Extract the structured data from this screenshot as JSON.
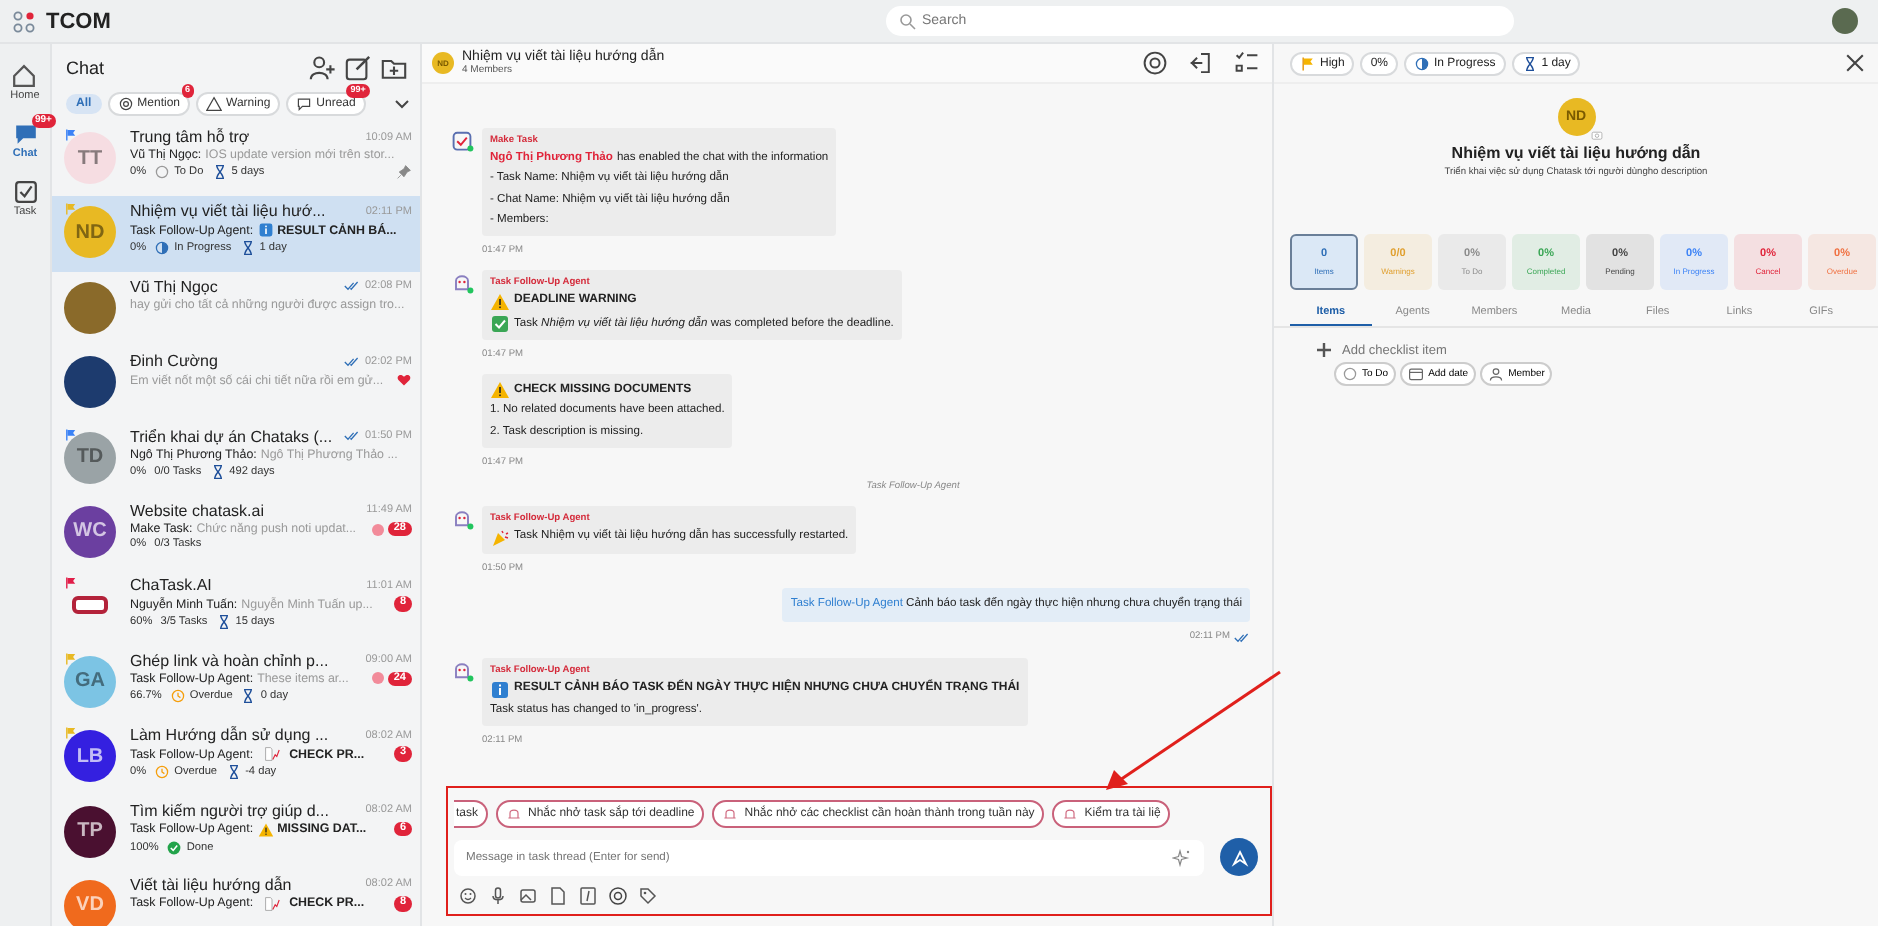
{
  "app": {
    "name": "TCOM"
  },
  "search": {
    "placeholder": "Search"
  },
  "rail": [
    {
      "label": "Home",
      "selected": false
    },
    {
      "label": "Chat",
      "selected": true,
      "badge": "99+"
    },
    {
      "label": "Task",
      "selected": false
    }
  ],
  "chat_list": {
    "title": "Chat",
    "filters": [
      {
        "label": "All",
        "selected": true
      },
      {
        "label": "Mention",
        "selected": false,
        "badge": "6"
      },
      {
        "label": "Warning",
        "selected": false
      },
      {
        "label": "Unread",
        "selected": false,
        "badge": "99+"
      }
    ],
    "items": [
      {
        "avatar": {
          "kind": "initials",
          "text": "TT",
          "color": "#f6dde2"
        },
        "flag": {
          "color": "#3b82f6"
        },
        "title": "Trung tâm hỗ trợ",
        "time": "10:09 AM",
        "read": false,
        "sender": "Vũ Thị Ngọc:",
        "preview": {
          "kind": "plain",
          "text": "IOS update version mới trên stor..."
        },
        "meta": [
          {
            "kind": "percent",
            "text": "0%"
          },
          {
            "kind": "todo",
            "text": "To Do"
          },
          {
            "kind": "duration",
            "text": "5 days"
          }
        ],
        "pinned": true,
        "liked": false,
        "dot": false,
        "selected": false
      },
      {
        "avatar": {
          "kind": "initials",
          "text": "ND",
          "color": "#e8b923"
        },
        "flag": {
          "color": "#e8b923"
        },
        "title": "Nhiệm vụ viết tài liệu hướ...",
        "time": "02:11 PM",
        "read": false,
        "sender": "Task Follow-Up Agent:",
        "preview": {
          "kind": "info",
          "text": "RESULT CẢNH BÁ..."
        },
        "meta": [
          {
            "kind": "percent",
            "text": "0%"
          },
          {
            "kind": "progress",
            "text": "In Progress"
          },
          {
            "kind": "duration",
            "text": "1 day"
          }
        ],
        "pinned": false,
        "liked": false,
        "dot": false,
        "selected": true
      },
      {
        "avatar": {
          "kind": "photo",
          "color": "#8a6a2a"
        },
        "title": "Vũ Thị Ngọc",
        "time": "02:08 PM",
        "read": true,
        "preview": {
          "kind": "plain",
          "text": "hay gửi cho tất cả những người được assign tro..."
        },
        "pinned": false,
        "liked": false,
        "dot": false,
        "selected": false
      },
      {
        "avatar": {
          "kind": "photo",
          "color": "#1d3b6e"
        },
        "title": "Đinh Cường",
        "time": "02:02 PM",
        "read": true,
        "preview": {
          "kind": "plain",
          "text": "Em viết nốt một số cái chi tiết nữa rồi em gử..."
        },
        "pinned": false,
        "liked": true,
        "dot": false,
        "selected": false
      },
      {
        "avatar": {
          "kind": "initials",
          "text": "TD",
          "color": "#9aa3a6"
        },
        "flag": {
          "color": "#3b82f6"
        },
        "title": "Triển khai dự án Chataks (...",
        "time": "01:50 PM",
        "read": true,
        "sender": "Ngô Thị Phương Thảo:",
        "preview": {
          "kind": "plain",
          "text": "Ngô Thị Phương Thảo ..."
        },
        "meta": [
          {
            "kind": "percent",
            "text": "0%"
          },
          {
            "kind": "tasks",
            "text": "0/0 Tasks"
          },
          {
            "kind": "duration",
            "text": "492 days"
          }
        ],
        "pinned": false,
        "liked": false,
        "dot": false,
        "selected": false
      },
      {
        "avatar": {
          "kind": "initials",
          "text": "WC",
          "color": "#6b3fa0"
        },
        "title": "Website chatask.ai",
        "time": "11:49 AM",
        "read": false,
        "sender": "Make Task:",
        "preview": {
          "kind": "plain",
          "text": "Chức năng push noti updat..."
        },
        "meta": [
          {
            "kind": "percent",
            "text": "0%"
          },
          {
            "kind": "tasks",
            "text": "0/3 Tasks"
          }
        ],
        "pinned": false,
        "liked": false,
        "dot": true,
        "badge": "28",
        "selected": false
      },
      {
        "avatar": {
          "kind": "logo",
          "color": "#b3223a"
        },
        "flag": {
          "color": "#e11d48"
        },
        "title": "ChaTask.AI",
        "time": "11:01 AM",
        "read": false,
        "sender": "Nguyễn Minh Tuấn:",
        "preview": {
          "kind": "plain",
          "text": "Nguyễn Minh Tuấn up..."
        },
        "meta": [
          {
            "kind": "percent",
            "text": "60%"
          },
          {
            "kind": "tasks",
            "text": "3/5 Tasks"
          },
          {
            "kind": "duration",
            "text": "15 days"
          }
        ],
        "pinned": false,
        "liked": false,
        "dot": false,
        "badge": "8",
        "selected": false
      },
      {
        "avatar": {
          "kind": "initials",
          "text": "GA",
          "color": "#7cc4e4"
        },
        "flag": {
          "color": "#e8b923"
        },
        "title": "Ghép link và hoàn chỉnh p...",
        "time": "09:00 AM",
        "read": false,
        "sender": "Task Follow-Up Agent:",
        "preview": {
          "kind": "plain",
          "text": "These items ar..."
        },
        "meta": [
          {
            "kind": "percent",
            "text": "66.7%"
          },
          {
            "kind": "overdue",
            "text": "Overdue"
          },
          {
            "kind": "duration",
            "text": "0 day"
          }
        ],
        "pinned": false,
        "liked": false,
        "dot": true,
        "badge": "24",
        "selected": false
      },
      {
        "avatar": {
          "kind": "initials",
          "text": "LB",
          "color": "#3420e0"
        },
        "flag": {
          "color": "#e8b923"
        },
        "title": "Làm Hướng dẫn sử dụng ...",
        "time": "08:02 AM",
        "read": false,
        "sender": "Task Follow-Up Agent:",
        "preview": {
          "kind": "report",
          "text": "CHECK PR..."
        },
        "meta": [
          {
            "kind": "percent",
            "text": "0%"
          },
          {
            "kind": "overdue",
            "text": "Overdue"
          },
          {
            "kind": "duration",
            "text": "-4 day"
          }
        ],
        "pinned": false,
        "liked": false,
        "dot": false,
        "badge": "3",
        "selected": false
      },
      {
        "avatar": {
          "kind": "initials",
          "text": "TP",
          "color": "#4a1030"
        },
        "title": "Tìm kiếm người trợ giúp d...",
        "time": "08:02 AM",
        "read": false,
        "sender": "Task Follow-Up Agent:",
        "preview": {
          "kind": "warning",
          "text": "MISSING DAT..."
        },
        "meta": [
          {
            "kind": "percent",
            "text": "100%"
          },
          {
            "kind": "done",
            "text": "Done"
          }
        ],
        "pinned": false,
        "liked": false,
        "dot": false,
        "badge": "6",
        "selected": false
      },
      {
        "avatar": {
          "kind": "initials",
          "text": "VD",
          "color": "#f06a1d"
        },
        "title": "Viết tài liệu hướng dẫn",
        "time": "08:02 AM",
        "read": false,
        "sender": "Task Follow-Up Agent:",
        "preview": {
          "kind": "report",
          "text": "CHECK PR..."
        },
        "pinned": false,
        "liked": false,
        "dot": false,
        "badge": "8",
        "selected": false
      }
    ]
  },
  "conversation": {
    "avatar": "ND",
    "title": "Nhiệm vụ viết tài liệu hướng dẫn",
    "subtitle": "4 Members",
    "messages": [
      {
        "kind": "incoming",
        "agent": {
          "kind": "task"
        },
        "sender": "Make Task",
        "mention": "Ngô Thị Phương Thảo",
        "text": "has enabled the chat with the information",
        "lines": [
          {
            "kind": "plain",
            "text": "- Task Name: Nhiệm vụ viết tài liệu hướng dẫn"
          },
          {
            "kind": "plain",
            "text": "- Chat Name: Nhiệm vụ viết tài liệu hướng dẫn"
          },
          {
            "kind": "plain",
            "text": "- Members:"
          }
        ],
        "time": "01:47 PM"
      },
      {
        "kind": "incoming",
        "agent": {
          "kind": "bot"
        },
        "sender": "Task Follow-Up Agent",
        "heading": {
          "kind": "warning",
          "text": "DEADLINE WARNING"
        },
        "lines": [
          {
            "kind": "check",
            "text": "Task *Nhiệm vụ viết tài liệu hướng dẫn* was completed before the deadline."
          }
        ],
        "time": "01:47 PM"
      },
      {
        "kind": "incoming",
        "heading": {
          "kind": "warning",
          "text": "CHECK MISSING DOCUMENTS"
        },
        "lines": [
          {
            "kind": "plain",
            "text": "1. No related documents have been attached."
          },
          {
            "kind": "plain",
            "text": "2. Task description is missing."
          }
        ],
        "time": "01:47 PM"
      },
      {
        "kind": "system",
        "text": "Task Follow-Up Agent"
      },
      {
        "kind": "incoming",
        "agent": {
          "kind": "bot"
        },
        "sender": "Task Follow-Up Agent",
        "lines": [
          {
            "kind": "party",
            "text": "Task Nhiệm vụ viết tài liệu hướng dẫn has successfully restarted."
          }
        ],
        "time": "01:50 PM"
      },
      {
        "kind": "outgoing",
        "mention": "Task Follow-Up Agent",
        "text": "Cảnh báo task đến ngày thực hiện nhưng chưa chuyển trạng thái",
        "time": "02:11 PM",
        "read": true
      },
      {
        "kind": "incoming",
        "agent": {
          "kind": "bot"
        },
        "sender": "Task Follow-Up Agent",
        "heading": {
          "kind": "info",
          "text": "RESULT CẢNH BÁO TASK ĐẾN NGÀY THỰC HIỆN NHƯNG CHƯA CHUYỂN TRẠNG THÁI"
        },
        "lines": [
          {
            "kind": "plain",
            "text": "Task status has changed to 'in_progress'."
          }
        ],
        "time": "02:11 PM"
      }
    ],
    "suggestions": [
      "task",
      "Nhắc nhở task sắp tới deadline",
      "Nhắc nhở các checklist cần hoàn thành trong tuần này",
      "Kiểm tra tài liệ"
    ],
    "composer": {
      "placeholder": "Message in task thread (Enter for send)"
    }
  },
  "task_panel": {
    "chips": [
      {
        "kind": "priority",
        "text": "High"
      },
      {
        "kind": "percent",
        "text": "0%"
      },
      {
        "kind": "progress",
        "text": "In Progress"
      },
      {
        "kind": "duration",
        "text": "1 day"
      }
    ],
    "avatar": "ND",
    "title": "Nhiệm vụ viết tài liệu hướng dẫn",
    "description": "Triển khai việc sử dụng Chatask tới người dùngho description",
    "stats": [
      {
        "value": "0",
        "label": "Items",
        "color": "#2f6fb7",
        "selected": true
      },
      {
        "value": "0/0",
        "label": "Warnings",
        "color": "#e0a030",
        "selected": false
      },
      {
        "value": "0%",
        "label": "To Do",
        "color": "#8a8a8a",
        "selected": false
      },
      {
        "value": "0%",
        "label": "Completed",
        "color": "#3aa655",
        "selected": false
      },
      {
        "value": "0%",
        "label": "Pending",
        "color": "#444444",
        "selected": false
      },
      {
        "value": "0%",
        "label": "In Progress",
        "color": "#3b82f6",
        "selected": false
      },
      {
        "value": "0%",
        "label": "Cancel",
        "color": "#e0243a",
        "selected": false
      },
      {
        "value": "0%",
        "label": "Overdue",
        "color": "#f07040",
        "selected": false
      }
    ],
    "tabs": [
      {
        "label": "Items",
        "selected": true
      },
      {
        "label": "Agents",
        "selected": false
      },
      {
        "label": "Members",
        "selected": false
      },
      {
        "label": "Media",
        "selected": false
      },
      {
        "label": "Files",
        "selected": false
      },
      {
        "label": "Links",
        "selected": false
      },
      {
        "label": "GIFs",
        "selected": false
      }
    ],
    "add_item": {
      "placeholder": "Add checklist item",
      "options": [
        {
          "kind": "todo",
          "text": "To Do"
        },
        {
          "kind": "date",
          "text": "Add date"
        },
        {
          "kind": "member",
          "text": "Member"
        }
      ]
    }
  }
}
